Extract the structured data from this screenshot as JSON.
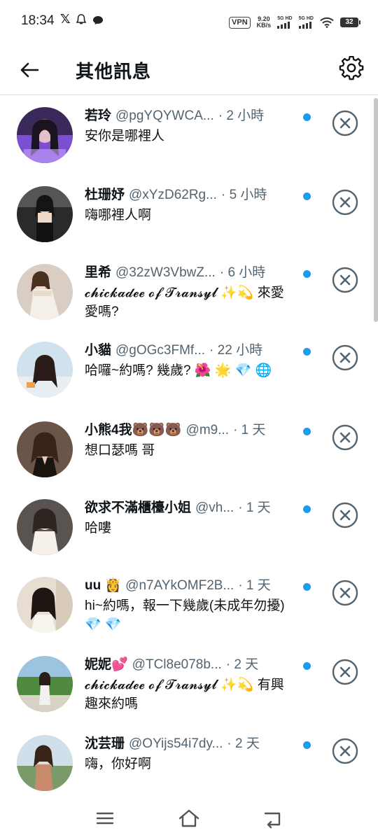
{
  "status_bar": {
    "time": "18:34",
    "notification_icons": [
      "x-logo-icon",
      "qq-icon",
      "chat-bubble-icon"
    ],
    "vpn_label": "VPN",
    "net_speed_value": "9.20",
    "net_speed_unit": "KB/s",
    "signal_1_label": "5G HD",
    "signal_2_label": "5G HD",
    "battery_level": "32"
  },
  "header": {
    "title": "其他訊息",
    "back_icon": "arrow-left-icon",
    "settings_icon": "gear-icon"
  },
  "colors": {
    "unread_dot": "#1d9bf0",
    "secondary_text": "#536471",
    "header_divider": "#cfe3ef"
  },
  "messages": [
    {
      "name": "若玲",
      "handle": "@pgYQYWCA...",
      "time": "· 2 小時",
      "preview": "安你是哪裡人",
      "unread": true
    },
    {
      "name": "杜珊妤",
      "handle": "@xYzD62Rg...",
      "time": "· 5 小時",
      "preview": "嗨哪裡人啊",
      "unread": true
    },
    {
      "name": "里希",
      "handle": "@32zW3VbwZ...",
      "time": "· 6 小時",
      "preview": "𝓬𝓱𝓲𝓬𝓴𝓪𝓭𝓮𝓮 𝓸𝓯 𝓣𝓻𝓪𝓷𝓼𝔂𝓵 ✨💫 來愛愛嗎?",
      "unread": true
    },
    {
      "name": "小貓",
      "handle": "@gOGc3FMf...",
      "time": "· 22 小時",
      "preview": "哈囉~約嗎? 幾歲? 🌺 🌟 💎 🌐",
      "unread": true
    },
    {
      "name": "小熊4我🐻🐻🐻",
      "handle": "@m9...",
      "time": "· 1 天",
      "preview": "想口瑟嗎 哥",
      "unread": true
    },
    {
      "name": "欲求不滿櫃檯小姐",
      "handle": "@vh...",
      "time": "· 1 天",
      "preview": "哈嘍",
      "unread": true
    },
    {
      "name": "uu 👸",
      "handle": "@n7AYkOMF2B...",
      "time": "· 1 天",
      "preview": "hi~約嗎，報一下幾歲(未成年勿擾) 💎 💎",
      "unread": true
    },
    {
      "name": "妮妮💕",
      "handle": "@TCl8e078b...",
      "time": "· 2 天",
      "preview": "𝓬𝓱𝓲𝓬𝓴𝓪𝓭𝓮𝓮 𝓸𝓯 𝓣𝓻𝓪𝓷𝓼𝔂𝓵 ✨💫 有興趣來約嗎",
      "unread": true
    },
    {
      "name": "沈芸珊",
      "handle": "@OYijs54i7dy...",
      "time": "· 2 天",
      "preview": "嗨，你好啊",
      "unread": true
    }
  ],
  "nav": {
    "menu_icon": "menu-icon",
    "home_icon": "home-icon",
    "back_icon": "back-icon"
  }
}
